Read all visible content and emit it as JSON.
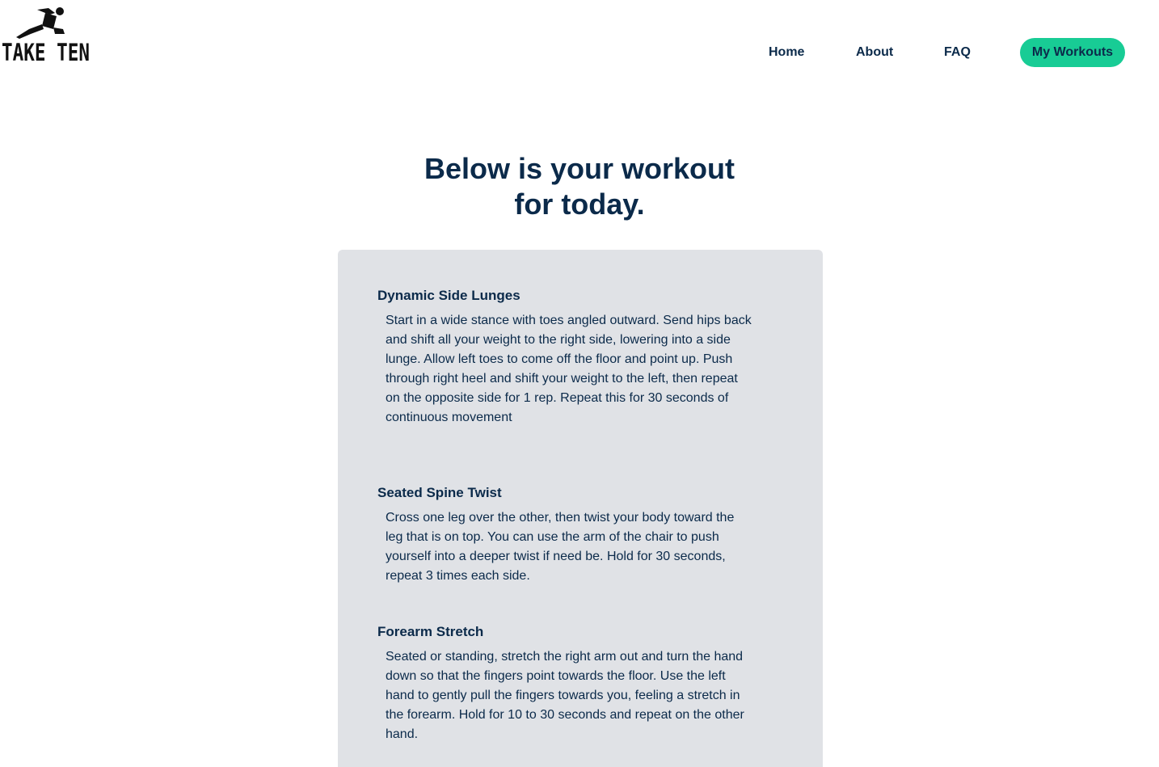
{
  "brand": {
    "name": "TAKE TEN",
    "logo_icon": "running-figure-icon"
  },
  "nav": {
    "home": "Home",
    "about": "About",
    "faq": "FAQ",
    "my_workouts": "My Workouts",
    "active_color": "#18cc95"
  },
  "headline": {
    "line1": "Below is your workout",
    "line2": "for today."
  },
  "exercises": [
    {
      "title": "Dynamic Side Lunges",
      "description": "Start in a wide stance with toes angled outward. Send hips back and shift all your weight to the right side, lowering into a side lunge. Allow left toes to come off the floor and point up. Push through right heel and shift your weight to the left, then repeat on the opposite side for 1 rep. Repeat this for 30 seconds of continuous movement"
    },
    {
      "title": "Seated Spine Twist",
      "description": "Cross one leg over the other, then twist your body toward the leg that is on top. You can use the arm of the chair to push yourself into a deeper twist if need be. Hold for 30 seconds, repeat 3 times each side."
    },
    {
      "title": "Forearm Stretch",
      "description": "Seated or standing, stretch the right arm out and turn the hand down so that the fingers point towards the floor. Use the left hand to gently pull the fingers towards you, feeling a stretch in the forearm. Hold for 10 to 30 seconds and repeat on the other hand."
    }
  ],
  "colors": {
    "text": "#0b2a4a",
    "card_bg": "#e0e2e6"
  }
}
